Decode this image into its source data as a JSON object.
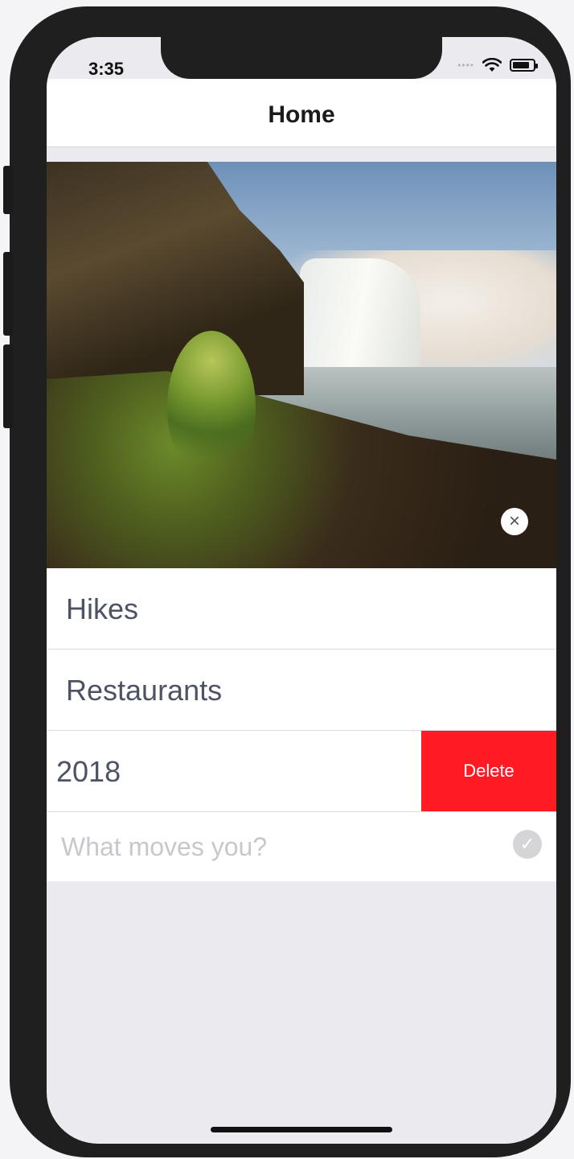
{
  "status_bar": {
    "time": "3:35",
    "signal_icon": "signal-dots-icon",
    "wifi_icon": "wifi-icon",
    "battery_icon": "battery-icon"
  },
  "navbar": {
    "title": "Home"
  },
  "hero": {
    "image_subject": "waterfall landscape",
    "close_icon": "close-icon"
  },
  "list": {
    "items": [
      {
        "label": "Hikes"
      },
      {
        "label": "Restaurants"
      },
      {
        "label": "l 2018",
        "swiped": true,
        "action_label": "Delete"
      }
    ]
  },
  "composer": {
    "placeholder": "What moves you?",
    "value": "",
    "submit_icon": "checkmark-icon"
  },
  "colors": {
    "delete": "#ff1a24",
    "row_text": "#4d5365",
    "placeholder": "#c7c8cd",
    "background": "#ebebef"
  }
}
